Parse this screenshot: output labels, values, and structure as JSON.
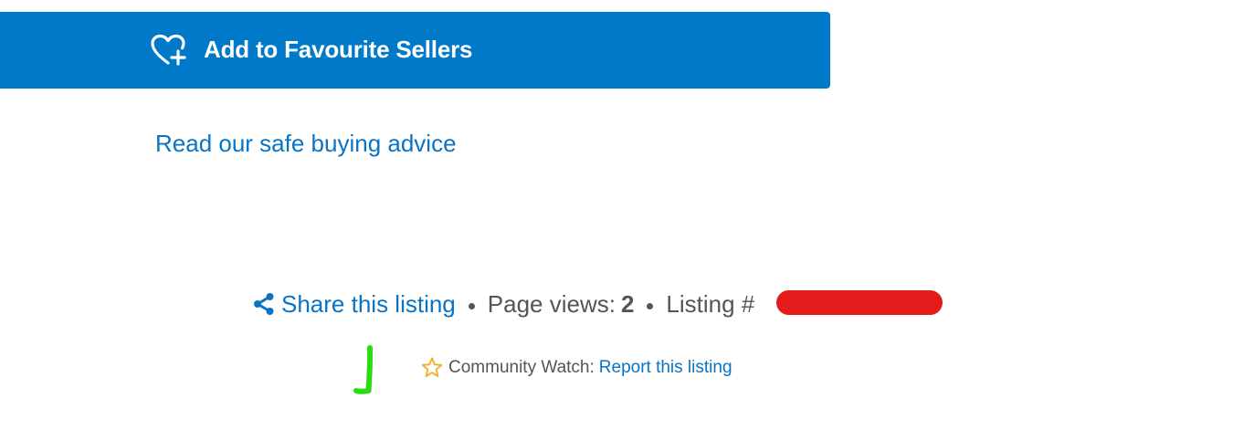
{
  "favourite_button": {
    "label": "Add to Favourite Sellers",
    "icon": "heart-plus-icon",
    "color": "#0079c8"
  },
  "safe_buying_link": {
    "label": "Read our safe buying advice"
  },
  "listing_meta": {
    "share_icon": "share-icon",
    "share_label": "Share this listing",
    "page_views_label": "Page views:",
    "page_views_count": "2",
    "listing_number_label": "Listing #"
  },
  "community_watch": {
    "star_icon": "star-outline-icon",
    "label": "Community Watch:",
    "report_label": "Report this listing"
  },
  "colors": {
    "link": "#0a74c4",
    "text": "#555555",
    "redaction": "#e31b1b",
    "annotation": "#2bdc12"
  }
}
